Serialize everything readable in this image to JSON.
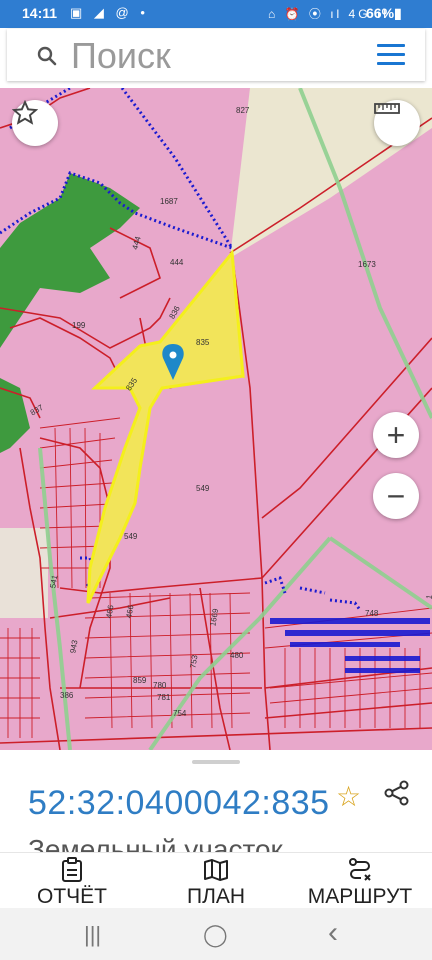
{
  "status_bar": {
    "time": "14:11",
    "left_icons": "▣ ◢ @ •",
    "right_icons": "⌂ ⏰ ⦿ ıl 4G ıl",
    "battery": "66%▮"
  },
  "search": {
    "placeholder": "Поиск"
  },
  "map": {
    "labels": {
      "l827": "827",
      "l1687": "1687",
      "l444a": "444",
      "l444b": "444",
      "l836": "836",
      "l835": "835",
      "l199": "199",
      "l1673": "1673",
      "l837": "837",
      "l835b": "835",
      "l549a": "549",
      "l549b": "549",
      "l541": "541",
      "l466a": "466",
      "l466b": "466",
      "l943": "943",
      "l1669": "1669",
      "l748": "748",
      "l859": "859",
      "l780": "780",
      "l753": "753",
      "l480": "480",
      "l781": "781",
      "l386": "386",
      "l754": "754",
      "l1n": "1"
    },
    "zoom_in": "+",
    "zoom_out": "−",
    "colors": {
      "land": "#e8a8cb",
      "highlight": "#f2e45a",
      "forest": "#3e9a3e",
      "boundary": "#cc1f2a",
      "route": "#8fcf8f",
      "dots": "#1a1ad0"
    }
  },
  "panel": {
    "cadastral_number": "52:32:0400042:835",
    "subtitle": "Земельный участок"
  },
  "actions": [
    {
      "label": "ОТЧЁТ"
    },
    {
      "label": "ПЛАН"
    },
    {
      "label": "МАРШРУТ"
    }
  ],
  "nav": {
    "recent": "|||",
    "home": "◯",
    "back": "‹"
  }
}
